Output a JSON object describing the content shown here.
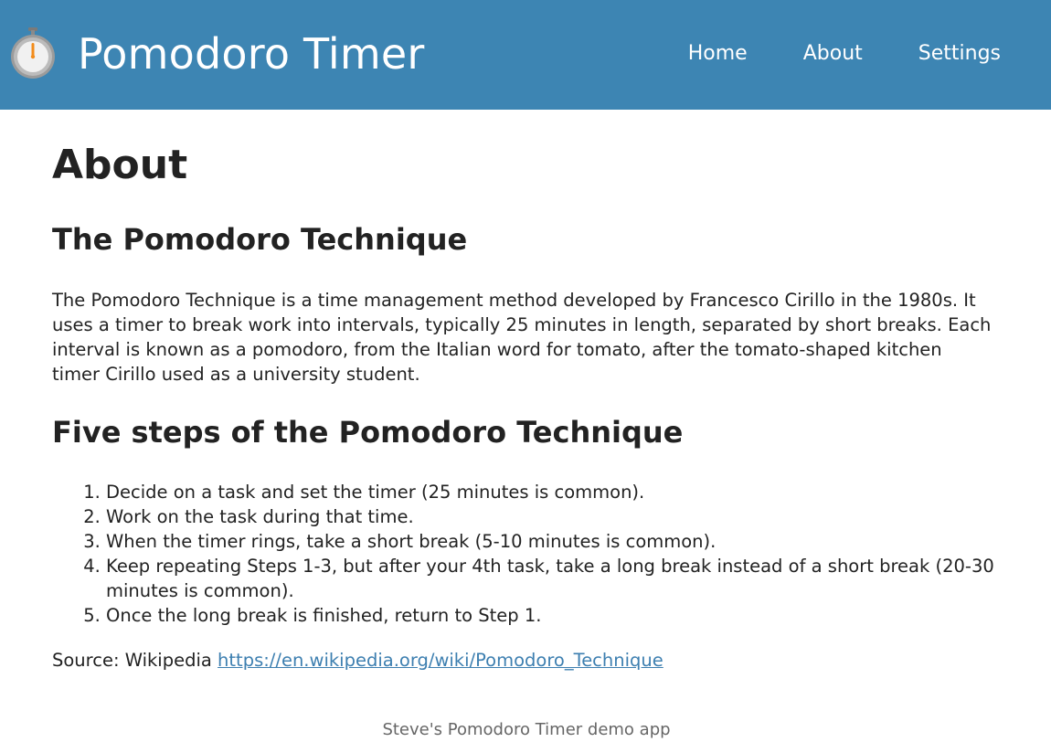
{
  "header": {
    "title": "Pomodoro Timer",
    "logo_icon": "stopwatch-icon",
    "background_color": "#3d85b3",
    "nav": [
      {
        "label": "Home"
      },
      {
        "label": "About"
      },
      {
        "label": "Settings"
      }
    ]
  },
  "main": {
    "page_title": "About",
    "section1_heading": "The Pomodoro Technique",
    "intro_text": "The Pomodoro Technique is a time management method developed by Francesco Cirillo in the 1980s. It uses a timer to break work into intervals, typically 25 minutes in length, separated by short breaks. Each interval is known as a pomodoro, from the Italian word for tomato, after the tomato-shaped kitchen timer Cirillo used as a university student.",
    "section2_heading": "Five steps of the Pomodoro Technique",
    "steps": [
      "Decide on a task and set the timer (25 minutes is common).",
      "Work on the task during that time.",
      "When the timer rings, take a short break (5-10 minutes is common).",
      "Keep repeating Steps 1-3, but after your 4th task, take a long break instead of a short break (20-30 minutes is common).",
      "Once the long break is finished, return to Step 1."
    ],
    "source_label": "Source: Wikipedia",
    "source_link": "https://en.wikipedia.org/wiki/Pomodoro_Technique",
    "link_color": "#3d7fb0"
  },
  "footer": {
    "text": "Steve's Pomodoro Timer demo app"
  }
}
